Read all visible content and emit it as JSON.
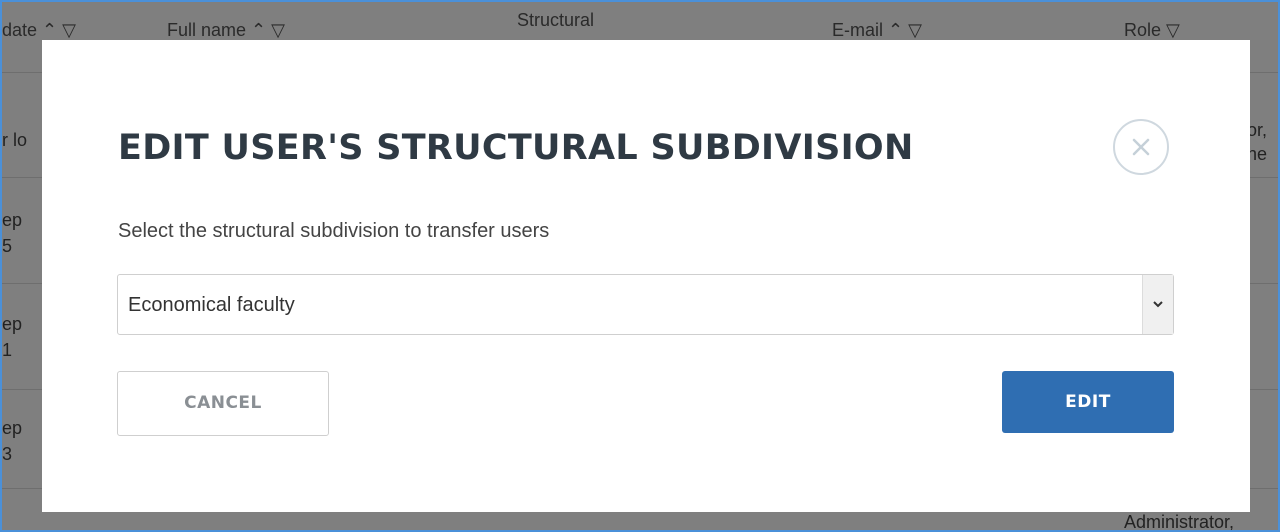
{
  "background_table": {
    "headers": [
      "date ⌃ ▽",
      "Full name ⌃ ▽",
      "Structural",
      "E-mail ⌃ ▽",
      "Role ▽"
    ],
    "left_fragments": [
      "r lo",
      "ep",
      "5",
      "ep",
      "1",
      "ep",
      "3"
    ],
    "right_fragments": [
      "or,",
      "ne"
    ],
    "bottom_right": "Administrator,"
  },
  "modal": {
    "title": "EDIT USER'S STRUCTURAL SUBDIVISION",
    "subtitle": "Select the structural subdivision to transfer users",
    "select_value": "Economical faculty",
    "cancel_label": "CANCEL",
    "edit_label": "EDIT"
  },
  "colors": {
    "primary_button": "#2f6eb2",
    "frame_border": "#4a90d9",
    "overlay": "rgba(0,0,0,0.5)"
  },
  "icons": {
    "close": "close-circle-icon",
    "dropdown": "chevron-down-icon"
  }
}
